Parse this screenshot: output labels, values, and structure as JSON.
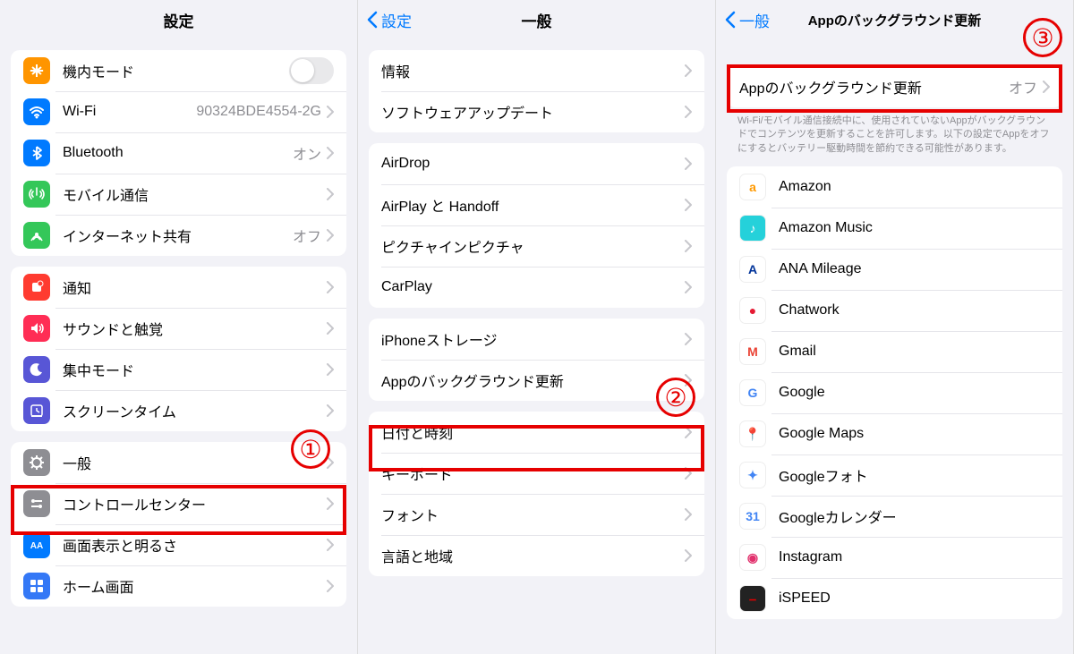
{
  "panel1": {
    "title": "設定",
    "marker": "①",
    "groups": [
      [
        {
          "icon": "airplane",
          "color": "#ff9500",
          "label": "機内モード",
          "toggle": true
        },
        {
          "icon": "wifi",
          "color": "#007aff",
          "label": "Wi-Fi",
          "value": "90324BDE4554-2G"
        },
        {
          "icon": "bluetooth",
          "color": "#007aff",
          "label": "Bluetooth",
          "value": "オン"
        },
        {
          "icon": "cellular",
          "color": "#34c759",
          "label": "モバイル通信"
        },
        {
          "icon": "hotspot",
          "color": "#34c759",
          "label": "インターネット共有",
          "value": "オフ"
        }
      ],
      [
        {
          "icon": "notifications",
          "color": "#ff3b30",
          "label": "通知"
        },
        {
          "icon": "sounds",
          "color": "#ff2d55",
          "label": "サウンドと触覚"
        },
        {
          "icon": "focus",
          "color": "#5856d6",
          "label": "集中モード"
        },
        {
          "icon": "screentime",
          "color": "#5856d6",
          "label": "スクリーンタイム"
        }
      ],
      [
        {
          "icon": "general",
          "color": "#8e8e93",
          "label": "一般",
          "highlight": true
        },
        {
          "icon": "control",
          "color": "#8e8e93",
          "label": "コントロールセンター"
        },
        {
          "icon": "display",
          "color": "#007aff",
          "label": "画面表示と明るさ"
        },
        {
          "icon": "home",
          "color": "#3478f6",
          "label": "ホーム画面"
        }
      ]
    ]
  },
  "panel2": {
    "back": "設定",
    "title": "一般",
    "marker": "②",
    "groups": [
      [
        {
          "label": "情報"
        },
        {
          "label": "ソフトウェアアップデート"
        }
      ],
      [
        {
          "label": "AirDrop"
        },
        {
          "label": "AirPlay と Handoff"
        },
        {
          "label": "ピクチャインピクチャ"
        },
        {
          "label": "CarPlay"
        }
      ],
      [
        {
          "label": "iPhoneストレージ"
        },
        {
          "label": "Appのバックグラウンド更新",
          "highlight": true
        }
      ],
      [
        {
          "label": "日付と時刻"
        },
        {
          "label": "キーボード"
        },
        {
          "label": "フォント"
        },
        {
          "label": "言語と地域"
        }
      ]
    ]
  },
  "panel3": {
    "back": "一般",
    "title": "Appのバックグラウンド更新",
    "marker": "③",
    "main": {
      "label": "Appのバックグラウンド更新",
      "value": "オフ",
      "highlight": true
    },
    "note": "Wi-Fi/モバイル通信接続中に、使用されていないAppがバックグラウンドでコンテンツを更新することを許可します。以下の設定でAppをオフにするとバッテリー駆動時間を節約できる可能性があります。",
    "apps": [
      {
        "name": "Amazon",
        "bg": "#fff",
        "fg": "#ff9900",
        "txt": "a"
      },
      {
        "name": "Amazon Music",
        "bg": "#25d1da",
        "fg": "#fff",
        "txt": "♪"
      },
      {
        "name": "ANA Mileage",
        "bg": "#fff",
        "fg": "#003399",
        "txt": "A"
      },
      {
        "name": "Chatwork",
        "bg": "#fff",
        "fg": "#e51a33",
        "txt": "●"
      },
      {
        "name": "Gmail",
        "bg": "#fff",
        "fg": "#ea4335",
        "txt": "M"
      },
      {
        "name": "Google",
        "bg": "#fff",
        "fg": "#4285f4",
        "txt": "G"
      },
      {
        "name": "Google Maps",
        "bg": "#fff",
        "fg": "#ea4335",
        "txt": "📍"
      },
      {
        "name": "Googleフォト",
        "bg": "#fff",
        "fg": "#4285f4",
        "txt": "✦"
      },
      {
        "name": "Googleカレンダー",
        "bg": "#fff",
        "fg": "#4285f4",
        "txt": "31"
      },
      {
        "name": "Instagram",
        "bg": "#fff",
        "fg": "#e1306c",
        "txt": "◉"
      },
      {
        "name": "iSPEED",
        "bg": "#222",
        "fg": "#e60000",
        "txt": "⎯"
      }
    ]
  }
}
